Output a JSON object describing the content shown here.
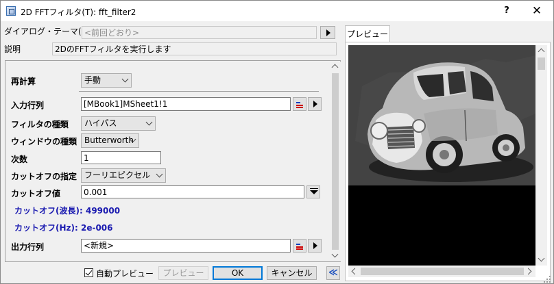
{
  "window": {
    "title": "2D FFTフィルタ(T): fft_filter2",
    "help_label": "?",
    "close_label": "✕"
  },
  "dialog_theme": {
    "label": "ダイアログ・テーマ(H)",
    "value": "<前回どおり>"
  },
  "description": {
    "label": "説明",
    "value": "2DのFFTフィルタを実行します"
  },
  "params": {
    "recalc": {
      "label": "再計算",
      "value": "手動"
    },
    "input_matrix": {
      "label": "入力行列",
      "value": "[MBook1]MSheet1!1"
    },
    "filter_type": {
      "label": "フィルタの種類",
      "value": "ハイパス"
    },
    "window_type": {
      "label": "ウィンドウの種類",
      "value": "Butterworth"
    },
    "order": {
      "label": "次数",
      "value": "1"
    },
    "cutoff_spec": {
      "label": "カットオフの指定",
      "value": "フーリエピクセル"
    },
    "cutoff_value": {
      "label": "カットオフ値",
      "value": "0.001"
    },
    "cutoff_wavelength": {
      "label": "カットオフ(波長):",
      "value": "499000"
    },
    "cutoff_hz": {
      "label": "カットオフ(Hz):",
      "value": "2e-006"
    },
    "output_matrix": {
      "label": "出力行列",
      "value": "<新規>"
    }
  },
  "footer": {
    "auto_preview_label": "自動プレビュー",
    "auto_preview_checked": true,
    "preview_button": "プレビュー",
    "ok_button": "OK",
    "cancel_button": "キャンセル",
    "collapse_button": "≪"
  },
  "preview": {
    "tab_label": "プレビュー"
  },
  "colors": {
    "accent": "#0078d7",
    "blue_label": "#1a1ab0",
    "preview_background": "#000000"
  }
}
